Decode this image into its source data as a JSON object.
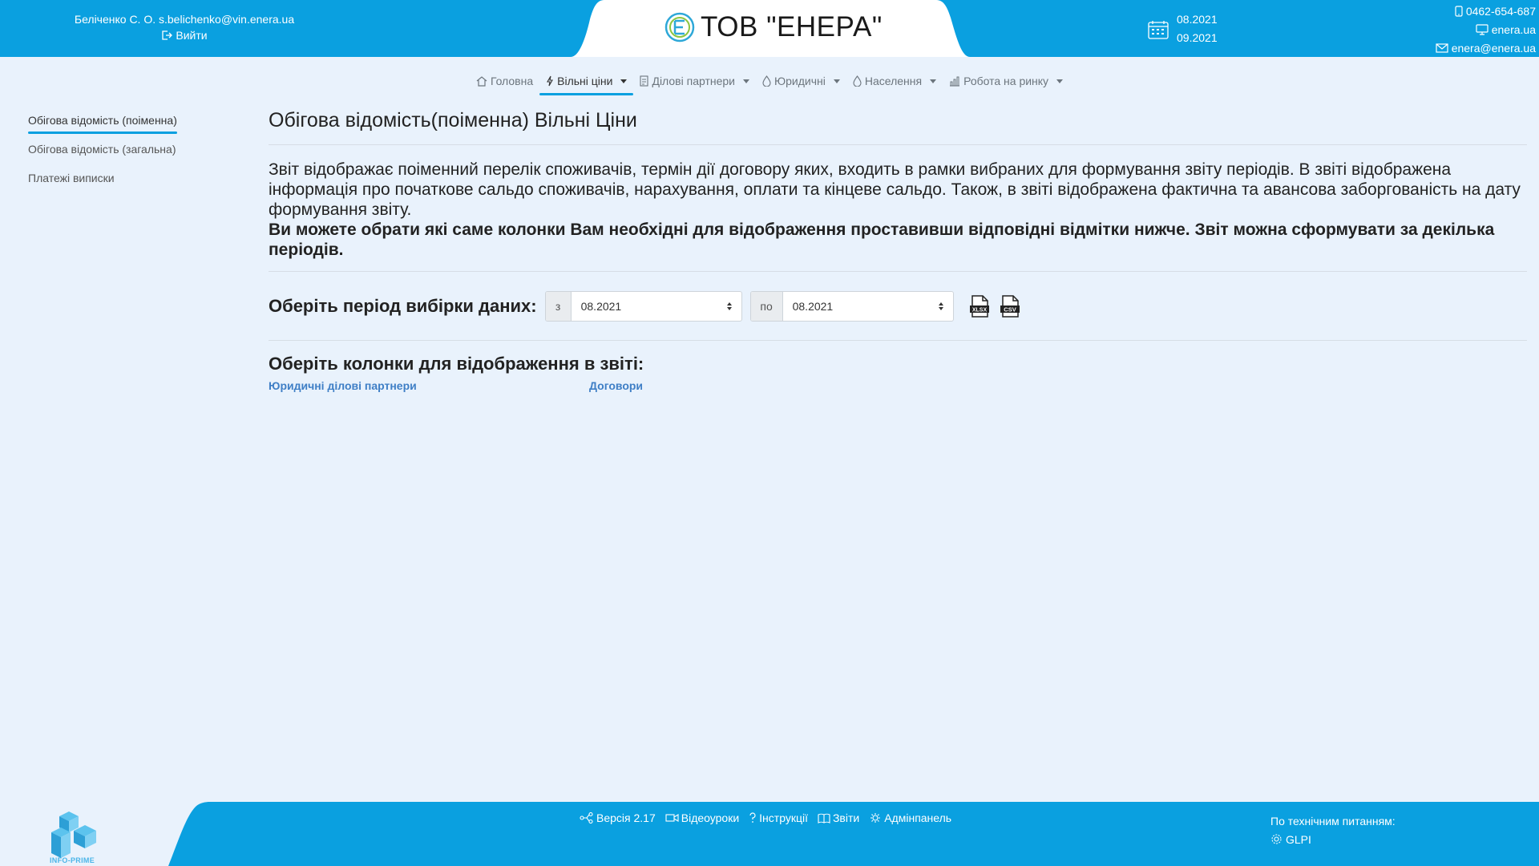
{
  "colors": {
    "accent": "#0aa0e0",
    "page_bg": "#e9f2fc",
    "link": "#3f7fc6"
  },
  "header": {
    "user": "Беліченко С. О. s.belichenko@vin.enera.ua",
    "logout_label": "Вийти",
    "brand_title": "ТОВ \"ЕНЕРА\"",
    "period_from": "08.2021",
    "period_to": "09.2021",
    "phone": "0462-654-687",
    "site": "enera.ua",
    "email": "enera@enera.ua"
  },
  "nav": {
    "items": [
      {
        "label": "Головна",
        "icon": "home-icon"
      },
      {
        "label": "Вільні ціни",
        "icon": "bolt-icon",
        "active": true,
        "dropdown": true
      },
      {
        "label": "Ділові партнери",
        "icon": "document-icon",
        "dropdown": true
      },
      {
        "label": "Юридичні",
        "icon": "drop-icon",
        "dropdown": true
      },
      {
        "label": "Населення",
        "icon": "drop-icon",
        "dropdown": true
      },
      {
        "label": "Робота на ринку",
        "icon": "chart-icon",
        "dropdown": true
      }
    ]
  },
  "sidebar": {
    "items": [
      {
        "label": "Обігова відомість (поіменна)",
        "active": true
      },
      {
        "label": "Обігова відомість (загальна)"
      },
      {
        "label": "Платежі виписки"
      }
    ]
  },
  "main": {
    "title": "Обігова відомість(поіменна) Вільні Ціни",
    "description": "Звіт відображає поіменний перелік споживачів, термін дії договору яких, входить в рамки вибраних для формування звіту періодів. В звіті відображена інформація про початкове сальдо споживачів, нарахування, оплати та кінцеве сальдо. Також, в звіті відображена фактична та авансова заборгованість на дату формування звіту.",
    "description_bold": "Ви можете обрати які саме колонки Вам необхідні для відображення проставивши відповідні відмітки нижче. Звіт можна сформувати за декілька періодів.",
    "period_label": "Оберіть період вибірки даних:",
    "from_prefix": "з",
    "from_value": "08.2021",
    "to_prefix": "по",
    "to_value": "08.2021",
    "xlsx_label": "XLSX",
    "csv_label": "CSV",
    "columns_title": "Оберіть колонки для відображення в звіті:",
    "column_groups": [
      "Юридичні ділові партнери",
      "Договори"
    ]
  },
  "footer": {
    "brand": "INFO-PRIME",
    "version": "Версія 2.17",
    "videos": "Відеоуроки",
    "instructions": "Інструкції",
    "reports": "Звіти",
    "admin": "Адмінпанель",
    "support_label": "По технічним питанням:",
    "glpi": "GLPI"
  }
}
